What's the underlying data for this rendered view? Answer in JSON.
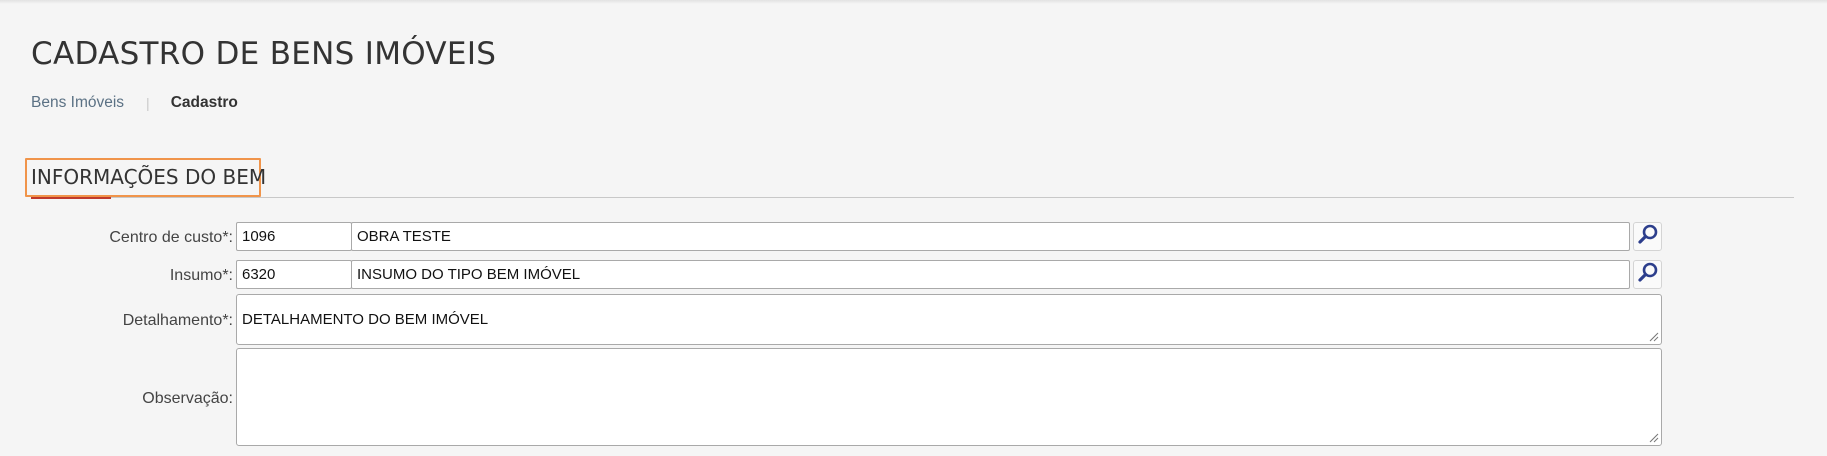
{
  "header": {
    "title": "CADASTRO DE BENS IMÓVEIS",
    "breadcrumb": {
      "parent": "Bens Imóveis",
      "separator": "|",
      "current": "Cadastro"
    }
  },
  "section": {
    "title": "INFORMAÇÕES DO BEM",
    "highlight_color": "#f0944a"
  },
  "form": {
    "centro_custo": {
      "label": "Centro de custo*:",
      "code": "1096",
      "description": "OBRA TESTE",
      "lookup_icon": "search-icon"
    },
    "insumo": {
      "label": "Insumo*:",
      "code": "6320",
      "description": "INSUMO DO TIPO BEM IMÓVEL",
      "lookup_icon": "search-icon"
    },
    "detalhamento": {
      "label": "Detalhamento*:",
      "value": "DETALHAMENTO DO BEM IMÓVEL"
    },
    "observacao": {
      "label": "Observação:",
      "value": ""
    }
  }
}
